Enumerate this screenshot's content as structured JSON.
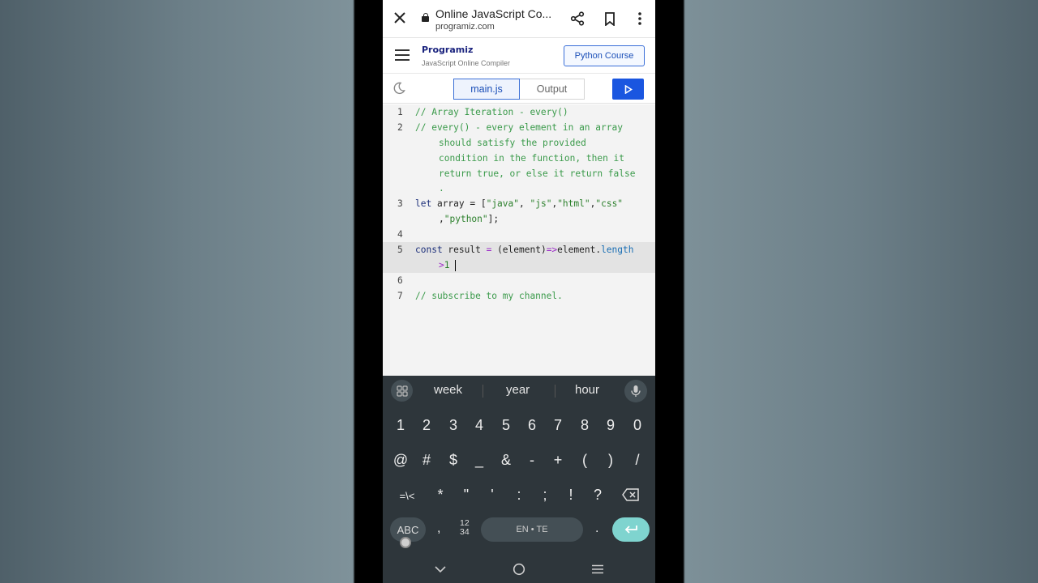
{
  "browser": {
    "page_title": "Online JavaScript Co...",
    "url": "programiz.com"
  },
  "site_header": {
    "logo": "Programiz",
    "subtitle": "JavaScript Online Compiler",
    "python_course_label": "Python Course"
  },
  "toolbar": {
    "tab_main": "main.js",
    "tab_output": "Output"
  },
  "editor": {
    "line_numbers": [
      "1",
      "2",
      "3",
      "4",
      "5",
      "6",
      "7"
    ],
    "line1": "// Array Iteration - every()",
    "line2a": "// every() - every element in an array",
    "line2b": "should satisfy the provided",
    "line2c": "condition in the function, then it",
    "line2d": "return true, or else it return false",
    "line2e": ".",
    "line3_kw": "let",
    "line3_var": " array = [",
    "line3_s1": "\"java\"",
    "line3_c1": ", ",
    "line3_s2": "\"js\"",
    "line3_c2": ",",
    "line3_s3": "\"html\"",
    "line3_c3": ",",
    "line3_s4": "\"css\"",
    "line3b_c": ",",
    "line3b_s5": "\"python\"",
    "line3b_end": "];",
    "line5_kw": "const",
    "line5_var": " result ",
    "line5_eq": "=",
    "line5_param": " (element)",
    "line5_arrow": "=>",
    "line5_obj": "element.",
    "line5_prop": "length",
    "line5b_op": ">",
    "line5b_num": "1",
    "line7": "// subscribe to my channel."
  },
  "keyboard": {
    "suggestions": [
      "week",
      "year",
      "hour"
    ],
    "row1": [
      "1",
      "2",
      "3",
      "4",
      "5",
      "6",
      "7",
      "8",
      "9",
      "0"
    ],
    "row2": [
      "@",
      "#",
      "$",
      "_",
      "&",
      "-",
      "+",
      "(",
      ")",
      "/"
    ],
    "row3": [
      "=\\<",
      "*",
      "\"",
      "'",
      ":",
      ";",
      "!",
      "?"
    ],
    "abc": "ABC",
    "comma": ",",
    "num_top": "12",
    "num_bottom": "34",
    "space": "EN • TE",
    "period": "."
  },
  "colors": {
    "accent_blue": "#1a56e0",
    "enter_key": "#7fd4cf",
    "keyboard_bg": "#2e363b"
  }
}
